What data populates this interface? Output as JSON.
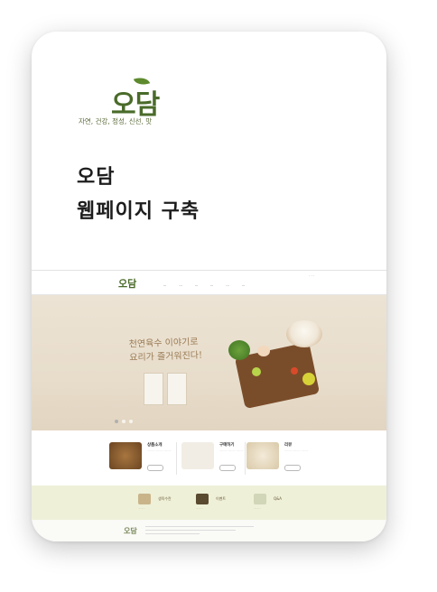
{
  "cover": {
    "logo_word": "오담",
    "logo_tagline": "자연, 건강, 정성, 신선, 맛",
    "title_line1": "오담",
    "title_line2": "웹페이지 구축"
  },
  "site": {
    "logo": "오담",
    "hero_copy_line1": "천연육수 이야기로",
    "hero_copy_line2": "요리가 즐거워진다!",
    "features": [
      {
        "title": "상품소개"
      },
      {
        "title": "구매하기"
      },
      {
        "title": "리뷰"
      }
    ],
    "bottom_items": [
      {
        "title": "생육수란"
      },
      {
        "title": "이벤트"
      },
      {
        "title": "Q&A"
      }
    ]
  },
  "colors": {
    "brand_green": "#4a6b2a",
    "hero_bg": "#e8ddcb",
    "band_bg": "#eef0d8"
  }
}
